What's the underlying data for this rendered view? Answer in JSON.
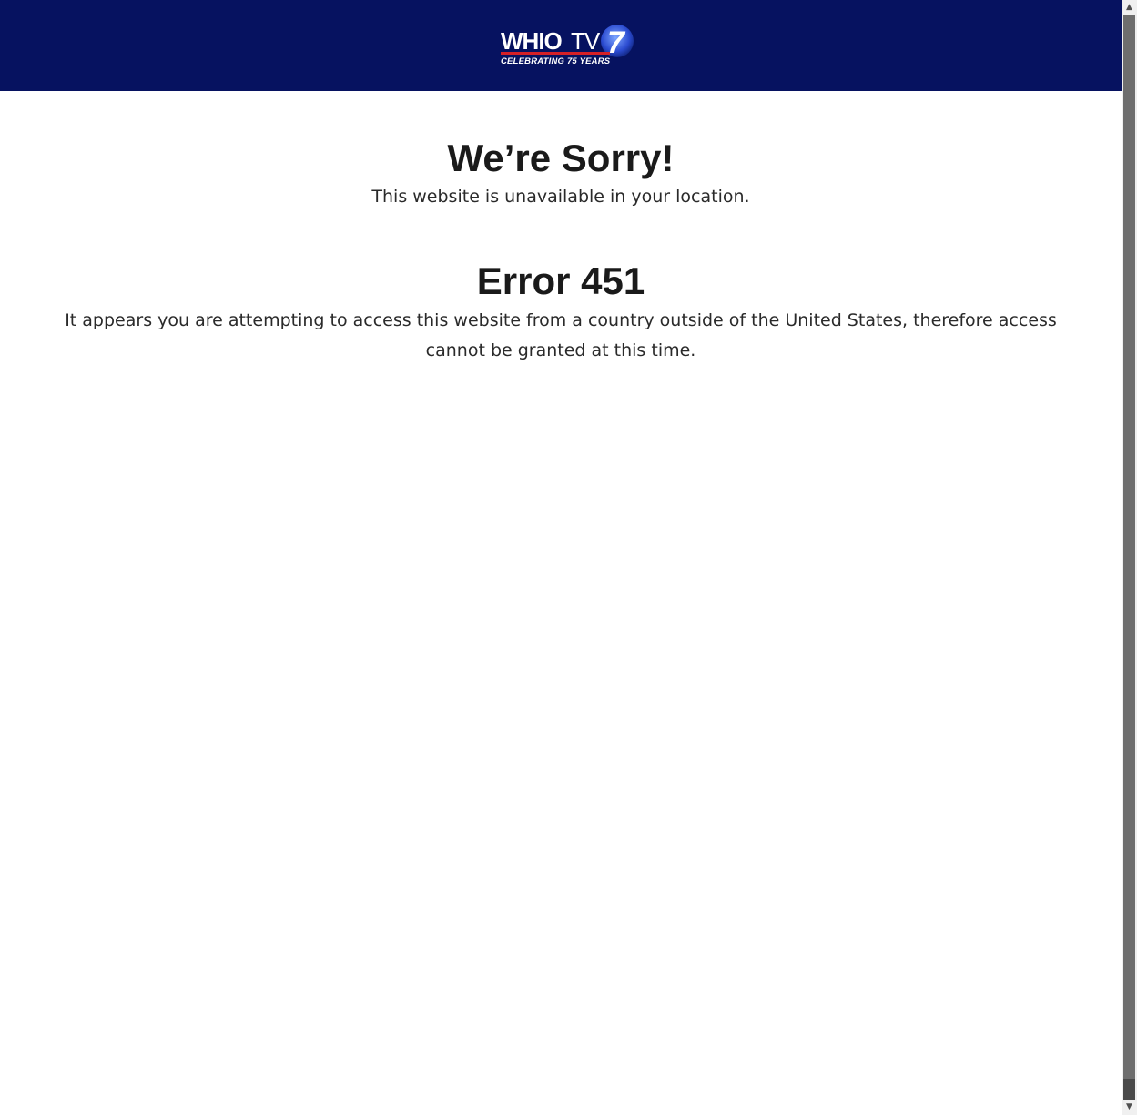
{
  "header": {
    "logo": {
      "brand": "WHIO",
      "brand_suffix": "TV",
      "channel_number": "7",
      "tagline": "CELEBRATING 75 YEARS"
    },
    "background_color": "#061260"
  },
  "main": {
    "sorry_title": "We’re Sorry!",
    "sorry_subtitle": "This website is unavailable in your location.",
    "error_title": "Error 451",
    "error_message": "It appears you are attempting to access this website from a country outside of the United States, therefore access cannot be granted at this time."
  },
  "scrollbar": {
    "up_arrow_icon": "▲",
    "down_arrow_icon": "▼"
  }
}
